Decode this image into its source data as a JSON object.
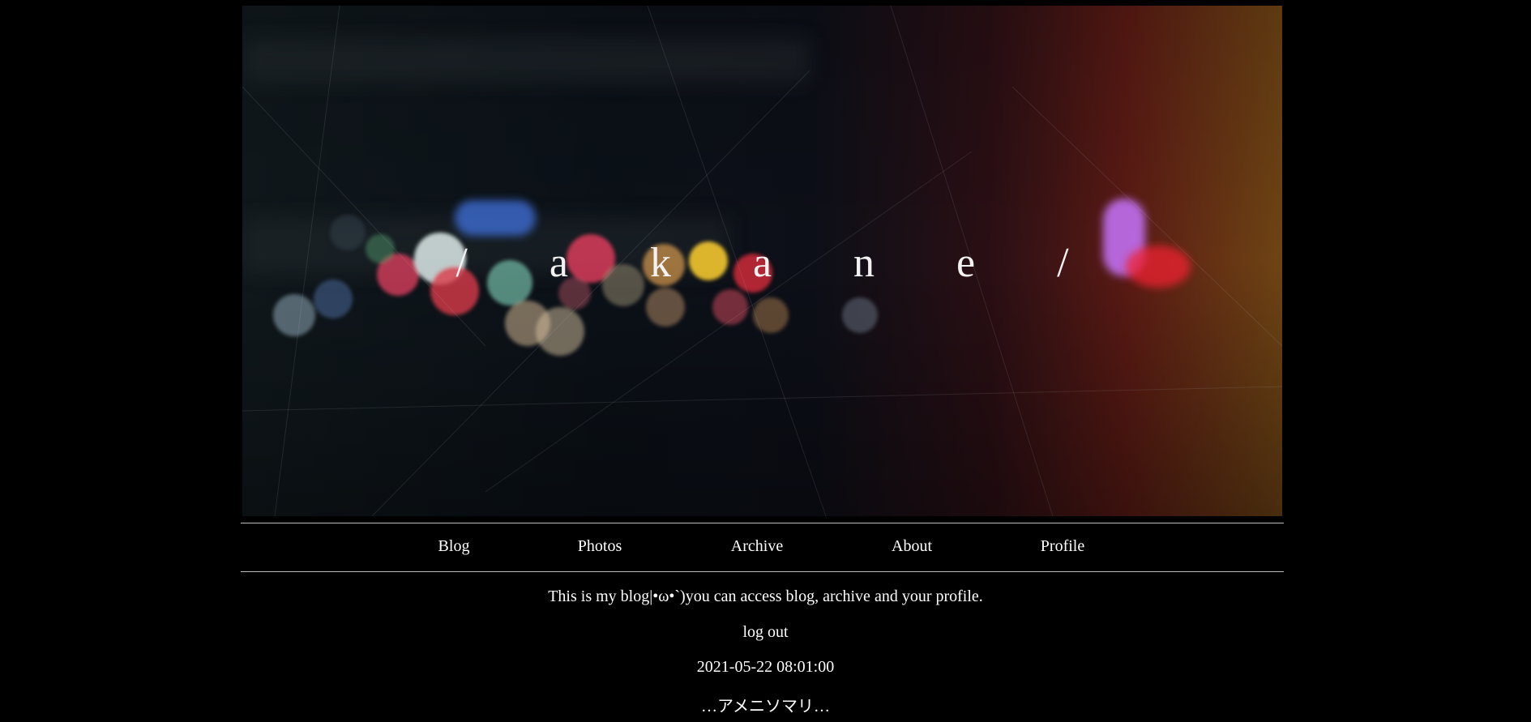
{
  "site": {
    "title": "/ a k a n e /"
  },
  "nav": {
    "items": [
      {
        "label": "Blog"
      },
      {
        "label": "Photos"
      },
      {
        "label": "Archive"
      },
      {
        "label": "About"
      },
      {
        "label": "Profile"
      }
    ]
  },
  "content": {
    "intro": "This is my blog|•ω•`)you can access blog, archive and your profile.",
    "logout_label": "log out",
    "post_date": "2021-05-22 08:01:00",
    "post_title": "…アメニソマリ…"
  },
  "colors": {
    "background": "#000000",
    "text": "#ffffff",
    "rule": "#bdbdbd"
  }
}
